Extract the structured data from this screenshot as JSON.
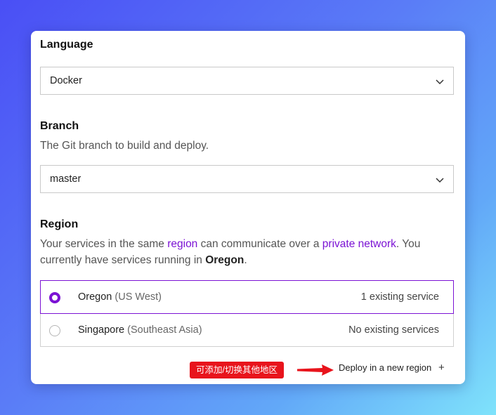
{
  "language": {
    "title": "Language",
    "selected": "Docker"
  },
  "branch": {
    "title": "Branch",
    "description": "The Git branch to build and deploy.",
    "selected": "master"
  },
  "region": {
    "title": "Region",
    "desc_1": "Your services in the same ",
    "desc_link_region": "region",
    "desc_2": " can communicate over a ",
    "desc_link_network": "private network",
    "desc_3": ". You currently have services running in ",
    "desc_current": "Oregon",
    "desc_4": ".",
    "options": [
      {
        "name": "Oregon",
        "sub": "(US West)",
        "count": "1 existing service",
        "selected": true
      },
      {
        "name": "Singapore",
        "sub": "(Southeast Asia)",
        "count": "No existing services",
        "selected": false
      }
    ],
    "deploy_new": "Deploy in a new region",
    "plus": "+"
  },
  "annotation": {
    "text": "可添加/切换其他地区",
    "color": "#e8141c"
  },
  "colors": {
    "accent": "#7b12d4"
  }
}
